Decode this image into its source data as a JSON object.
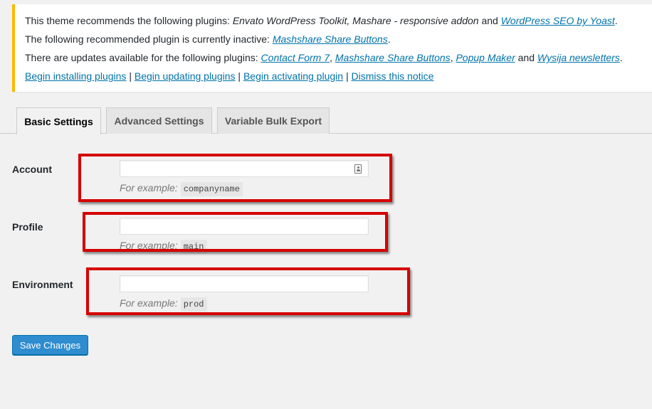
{
  "notice": {
    "line1": {
      "prefix": "This theme recommends the following plugins: ",
      "plugins_italic": "Envato WordPress Toolkit, Mashare - responsive addon",
      "and": " and ",
      "link": "WordPress SEO by Yoast",
      "suffix": "."
    },
    "line2": {
      "prefix": "The following recommended plugin is currently inactive: ",
      "link": "Mashshare Share Buttons",
      "suffix": "."
    },
    "line3": {
      "prefix": "There are updates available for the following plugins: ",
      "link1": "Contact Form 7",
      "comma1": ", ",
      "link2": "Mashshare Share Buttons",
      "comma2": ", ",
      "link3": "Popup Maker",
      "and": " and ",
      "link4": "Wysija newsletters",
      "suffix": "."
    },
    "actions": {
      "install": "Begin installing plugins",
      "update": "Begin updating plugins",
      "activate": "Begin activating plugin",
      "dismiss": "Dismiss this notice",
      "separator": " | "
    },
    "border_color": "#ffb900"
  },
  "tabs": [
    {
      "label": "Basic Settings",
      "active": true
    },
    {
      "label": "Advanced Settings",
      "active": false
    },
    {
      "label": "Variable Bulk Export",
      "active": false
    }
  ],
  "fields": {
    "account": {
      "label": "Account",
      "value": "",
      "example_prefix": "For example:",
      "example_code": "companyname"
    },
    "profile": {
      "label": "Profile",
      "value": "",
      "example_prefix": "For example:",
      "example_code": "main"
    },
    "environment": {
      "label": "Environment",
      "value": "",
      "example_prefix": "For example:",
      "example_code": "prod"
    }
  },
  "save_button": "Save Changes",
  "colors": {
    "link": "#0073aa",
    "button": "#2e8ccf",
    "highlight_box": "#d50000"
  },
  "icons": {
    "account_field_icon": "contact-card-icon"
  }
}
